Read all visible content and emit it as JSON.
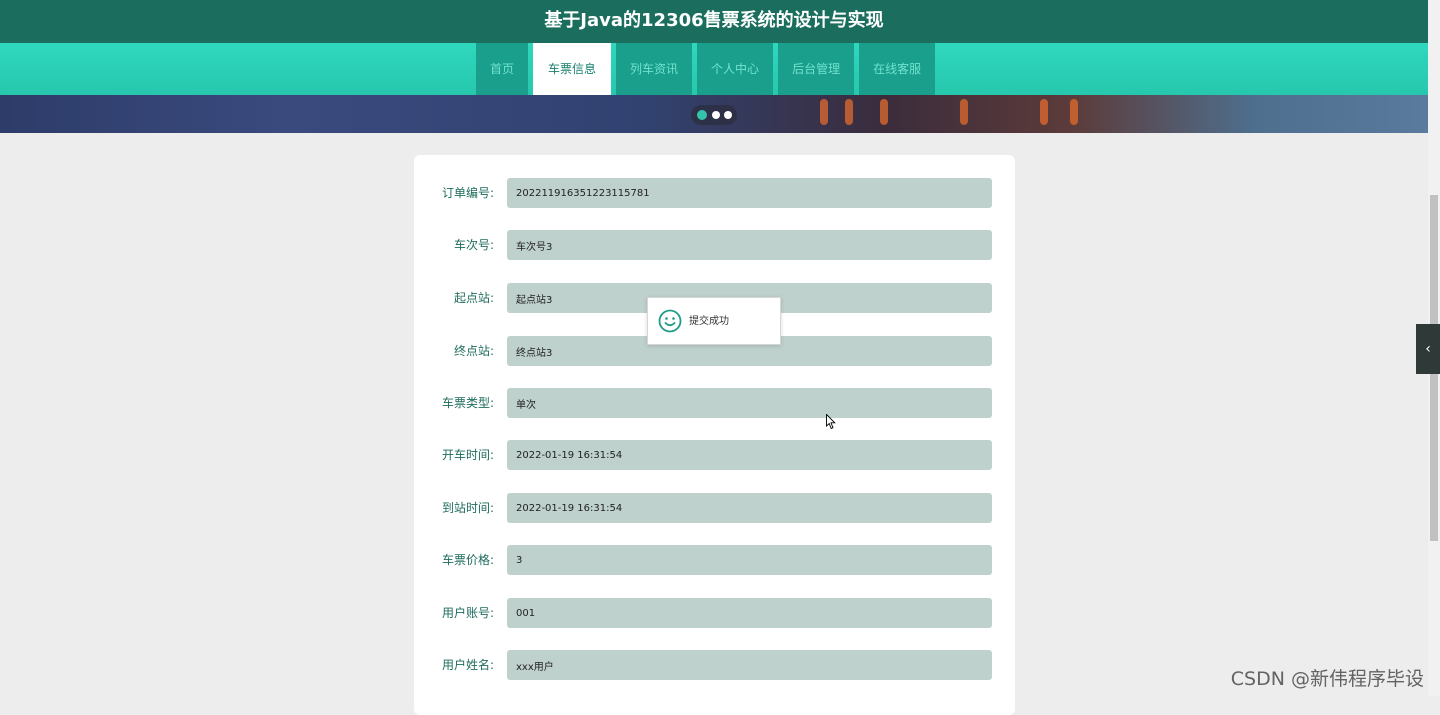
{
  "header": {
    "title": "基于Java的12306售票系统的设计与实现"
  },
  "nav": {
    "items": [
      {
        "label": "首页"
      },
      {
        "label": "车票信息",
        "active": true
      },
      {
        "label": "列车资讯"
      },
      {
        "label": "个人中心"
      },
      {
        "label": "后台管理"
      },
      {
        "label": "在线客服"
      }
    ]
  },
  "form": {
    "fields": [
      {
        "label": "订单编号:",
        "value": "202211916351223115781"
      },
      {
        "label": "车次号:",
        "value": "车次号3"
      },
      {
        "label": "起点站:",
        "value": "起点站3"
      },
      {
        "label": "终点站:",
        "value": "终点站3"
      },
      {
        "label": "车票类型:",
        "value": "单次"
      },
      {
        "label": "开车时间:",
        "value": "2022-01-19 16:31:54"
      },
      {
        "label": "到站时间:",
        "value": "2022-01-19 16:31:54"
      },
      {
        "label": "车票价格:",
        "value": "3"
      },
      {
        "label": "用户账号:",
        "value": "001"
      },
      {
        "label": "用户姓名:",
        "value": "xxx用户"
      }
    ]
  },
  "toast": {
    "message": "提交成功",
    "icon": "smile-icon"
  },
  "side_tab": {
    "icon": "‹"
  },
  "watermark": {
    "text": "CSDN @新伟程序毕设"
  },
  "colors": {
    "header_bg": "#1b6e5e",
    "nav_bg": "#2fd8bd",
    "nav_item_bg": "#199f8b",
    "input_bg": "#bfd1cd",
    "label_color": "#1f6c5d"
  }
}
